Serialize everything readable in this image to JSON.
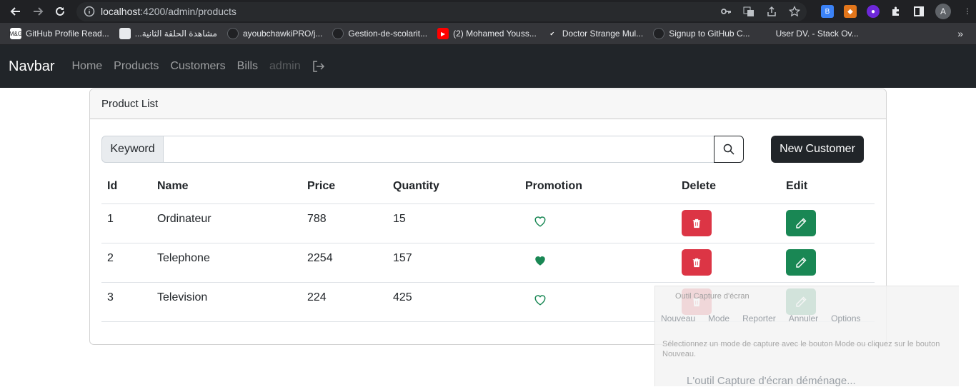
{
  "browser": {
    "url_host": "localhost",
    "url_path": ":4200/admin/products",
    "profile_initial": "A",
    "bookmarks": [
      {
        "label": "GitHub Profile Read...",
        "color": "#ffffff",
        "text": "M&G"
      },
      {
        "label": "...مشاهدة الحلقة الثانية",
        "color": "#e8eaed",
        "text": ""
      },
      {
        "label": "ayoubchawkiPRO/j...",
        "color": "#202124",
        "text": ""
      },
      {
        "label": "Gestion-de-scolarit...",
        "color": "#202124",
        "text": ""
      },
      {
        "label": "(2) Mohamed Youss...",
        "color": "#ff0000",
        "text": "▶"
      },
      {
        "label": "Doctor Strange Mul...",
        "color": "#35363a",
        "text": "✔"
      },
      {
        "label": "Signup to GitHub C...",
        "color": "#202124",
        "text": ""
      },
      {
        "label": "User DV. - Stack Ov...",
        "color": "#35363a",
        "text": ""
      }
    ],
    "bookmarks_more": "»"
  },
  "navbar": {
    "brand": "Navbar",
    "links": [
      "Home",
      "Products",
      "Customers",
      "Bills"
    ],
    "user": "admin"
  },
  "card": {
    "header": "Product List",
    "keyword_label": "Keyword",
    "keyword_value": "",
    "new_button": "New Customer",
    "columns": [
      "Id",
      "Name",
      "Price",
      "Quantity",
      "Promotion",
      "Delete",
      "Edit"
    ],
    "rows": [
      {
        "id": "1",
        "name": "Ordinateur",
        "price": "788",
        "quantity": "15",
        "promotion": false
      },
      {
        "id": "2",
        "name": "Telephone",
        "price": "2254",
        "quantity": "157",
        "promotion": true
      },
      {
        "id": "3",
        "name": "Television",
        "price": "224",
        "quantity": "425",
        "promotion": false
      }
    ]
  },
  "snipping_tool": {
    "title": "Outil Capture d'écran",
    "new": "Nouveau",
    "mode": "Mode",
    "delay": "Reporter",
    "cancel": "Annuler",
    "options": "Options",
    "description": "Sélectionnez un mode de capture avec le bouton Mode ou cliquez sur le bouton Nouveau.",
    "moving": "L'outil Capture d'écran déménage..."
  },
  "colors": {
    "danger": "#dc3545",
    "success": "#198754",
    "dark": "#212529"
  }
}
